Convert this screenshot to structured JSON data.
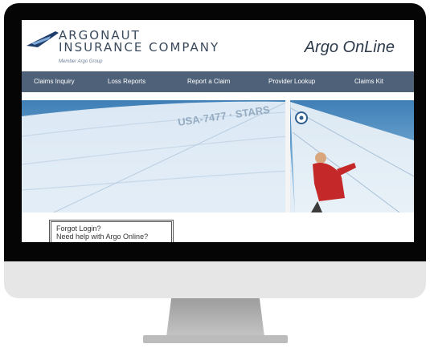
{
  "header": {
    "logo": {
      "line1": "ARGONAUT",
      "line2": "INSURANCE COMPANY",
      "tagline": "Member Argo Group"
    },
    "product_name": "Argo OnLine"
  },
  "nav": {
    "items": [
      {
        "label": "Claims Inquiry"
      },
      {
        "label": "Loss Reports"
      },
      {
        "label": "Report a Claim"
      },
      {
        "label": "Provider Lookup"
      },
      {
        "label": "Claims Kit"
      }
    ]
  },
  "hero": {
    "sail_lettering": "USA-7477 · STARS"
  },
  "login": {
    "forgot_login": "Forgot Login?",
    "need_help": "Need help with Argo Online?"
  },
  "colors": {
    "nav": "#4e6178",
    "sky": "#3f7fb6",
    "logo_text": "#3a4a5c",
    "bezel": "#050505"
  }
}
